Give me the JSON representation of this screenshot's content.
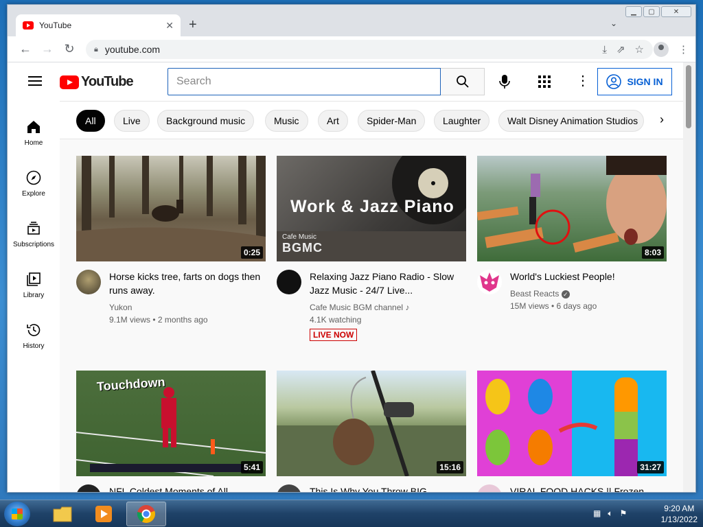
{
  "browser": {
    "tab_title": "YouTube",
    "url": "youtube.com"
  },
  "youtube": {
    "logo_text": "YouTube",
    "search_placeholder": "Search",
    "signin_label": "SIGN IN",
    "chips": [
      "All",
      "Live",
      "Background music",
      "Music",
      "Art",
      "Spider-Man",
      "Laughter",
      "Walt Disney Animation Studios"
    ],
    "sidebar": [
      {
        "label": "Home",
        "icon": "home-icon"
      },
      {
        "label": "Explore",
        "icon": "compass-icon"
      },
      {
        "label": "Subscriptions",
        "icon": "subscriptions-icon"
      },
      {
        "label": "Library",
        "icon": "library-icon"
      },
      {
        "label": "History",
        "icon": "history-icon"
      }
    ],
    "videos": [
      {
        "title": "Horse kicks tree, farts on dogs then runs away.",
        "channel": "Yukon",
        "stats": "9.1M views • 2 months ago",
        "duration": "0:25"
      },
      {
        "title": "Relaxing Jazz Piano Radio - Slow Jazz Music - 24/7 Live...",
        "channel": "Cafe Music BGM channel",
        "stats": "4.1K watching",
        "badge": "LIVE NOW",
        "thumb_text": "Work & Jazz Piano",
        "thumb_sub": "Cafe Music",
        "thumb_logo": "BGMC"
      },
      {
        "title": "World's Luckiest People!",
        "channel": "Beast Reacts",
        "stats": "15M views • 6 days ago",
        "duration": "8:03"
      },
      {
        "title": "NFL Coldest Moments of All...",
        "duration": "5:41",
        "thumb_text": "Touchdown"
      },
      {
        "title": "This Is Why You Throw BIG...",
        "duration": "15:16"
      },
      {
        "title": "VIRAL FOOD HACKS || Frozen...",
        "duration": "31:27"
      }
    ]
  },
  "taskbar": {
    "time": "9:20 AM",
    "date": "1/13/2022"
  }
}
